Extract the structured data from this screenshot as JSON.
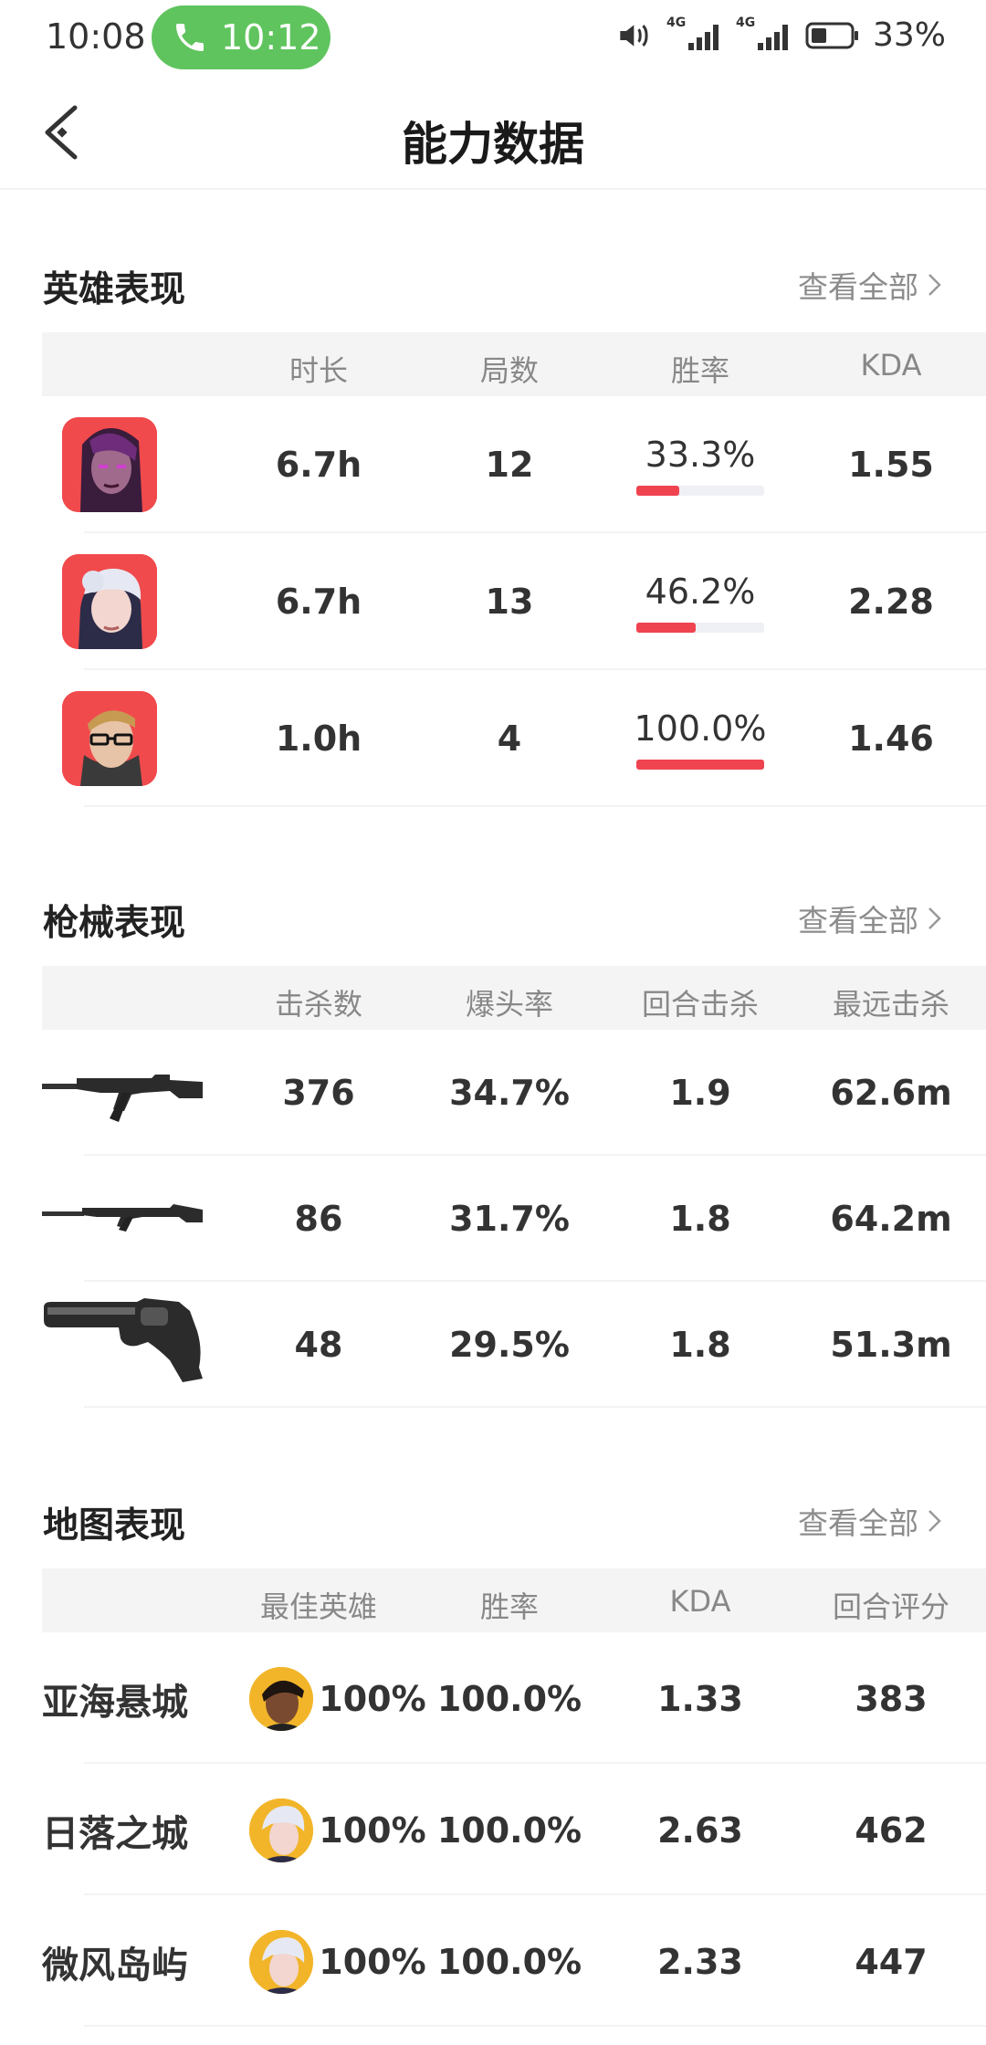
{
  "status_bar": {
    "time": "10:08",
    "call_time": "10:12",
    "net1": "4G",
    "net2": "4G",
    "battery": "33%"
  },
  "header": {
    "title": "能力数据"
  },
  "hero_section": {
    "title": "英雄表现",
    "view_all": "查看全部",
    "columns": [
      "时长",
      "局数",
      "胜率",
      "KDA"
    ],
    "rows": [
      {
        "icon": "hero-purple-hair-icon",
        "duration": "6.7h",
        "games": "12",
        "win_rate": "33.3%",
        "win_fraction": 0.333,
        "kda": "1.55"
      },
      {
        "icon": "hero-white-hair-icon",
        "duration": "6.7h",
        "games": "13",
        "win_rate": "46.2%",
        "win_fraction": 0.462,
        "kda": "2.28"
      },
      {
        "icon": "hero-glasses-icon",
        "duration": "1.0h",
        "games": "4",
        "win_rate": "100.0%",
        "win_fraction": 1.0,
        "kda": "1.46"
      }
    ]
  },
  "weapon_section": {
    "title": "枪械表现",
    "view_all": "查看全部",
    "columns": [
      "击杀数",
      "爆头率",
      "回合击杀",
      "最远击杀"
    ],
    "rows": [
      {
        "icon": "assault-rifle-icon",
        "kills": "376",
        "headshot": "34.7%",
        "round_kills": "1.9",
        "longest": "62.6m"
      },
      {
        "icon": "rifle-icon",
        "kills": "86",
        "headshot": "31.7%",
        "round_kills": "1.8",
        "longest": "64.2m"
      },
      {
        "icon": "revolver-icon",
        "kills": "48",
        "headshot": "29.5%",
        "round_kills": "1.8",
        "longest": "51.3m"
      }
    ]
  },
  "map_section": {
    "title": "地图表现",
    "view_all": "查看全部",
    "columns": [
      "最佳英雄",
      "胜率",
      "KDA",
      "回合评分"
    ],
    "rows": [
      {
        "map": "亚海悬城",
        "hero_icon": "dark-hero-avatar-icon",
        "hero_rate": "100%",
        "win_rate": "100.0%",
        "kda": "1.33",
        "score": "383"
      },
      {
        "map": "日落之城",
        "hero_icon": "white-hair-hero-avatar-icon",
        "hero_rate": "100%",
        "win_rate": "100.0%",
        "kda": "2.63",
        "score": "462"
      },
      {
        "map": "微风岛屿",
        "hero_icon": "white-hair-hero-avatar-icon",
        "hero_rate": "100%",
        "win_rate": "100.0%",
        "kda": "2.33",
        "score": "447"
      }
    ]
  },
  "colors": {
    "accent_red": "#f04350",
    "call_green": "#5fc45e",
    "header_bg": "#f4f4f4"
  }
}
